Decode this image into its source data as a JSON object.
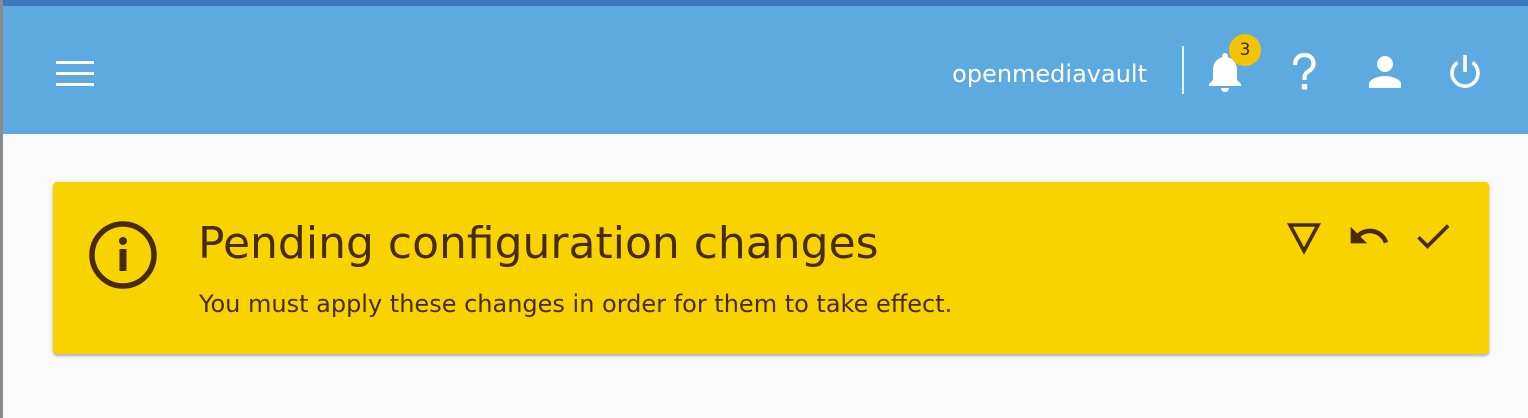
{
  "window": {
    "top_line_color": "#3c78bf",
    "page_background": "#fafafa"
  },
  "toolbar": {
    "background": "#5caadf",
    "menu_icon": "menu-icon",
    "hostname": "openmediavault",
    "notifications": {
      "icon": "bell-icon",
      "count": "3",
      "badge_color": "#f5c400"
    },
    "help_icon": "help-icon",
    "user_icon": "account-icon",
    "power_icon": "power-icon"
  },
  "banner": {
    "background": "#f7d400",
    "text_color": "#4a2a0c",
    "icon": "info-icon",
    "title": "Pending configuration changes",
    "message": "You must apply these changes in order for them to take effect.",
    "actions": [
      {
        "icon": "filter-triangle-icon"
      },
      {
        "icon": "undo-icon"
      },
      {
        "icon": "check-icon"
      }
    ]
  }
}
